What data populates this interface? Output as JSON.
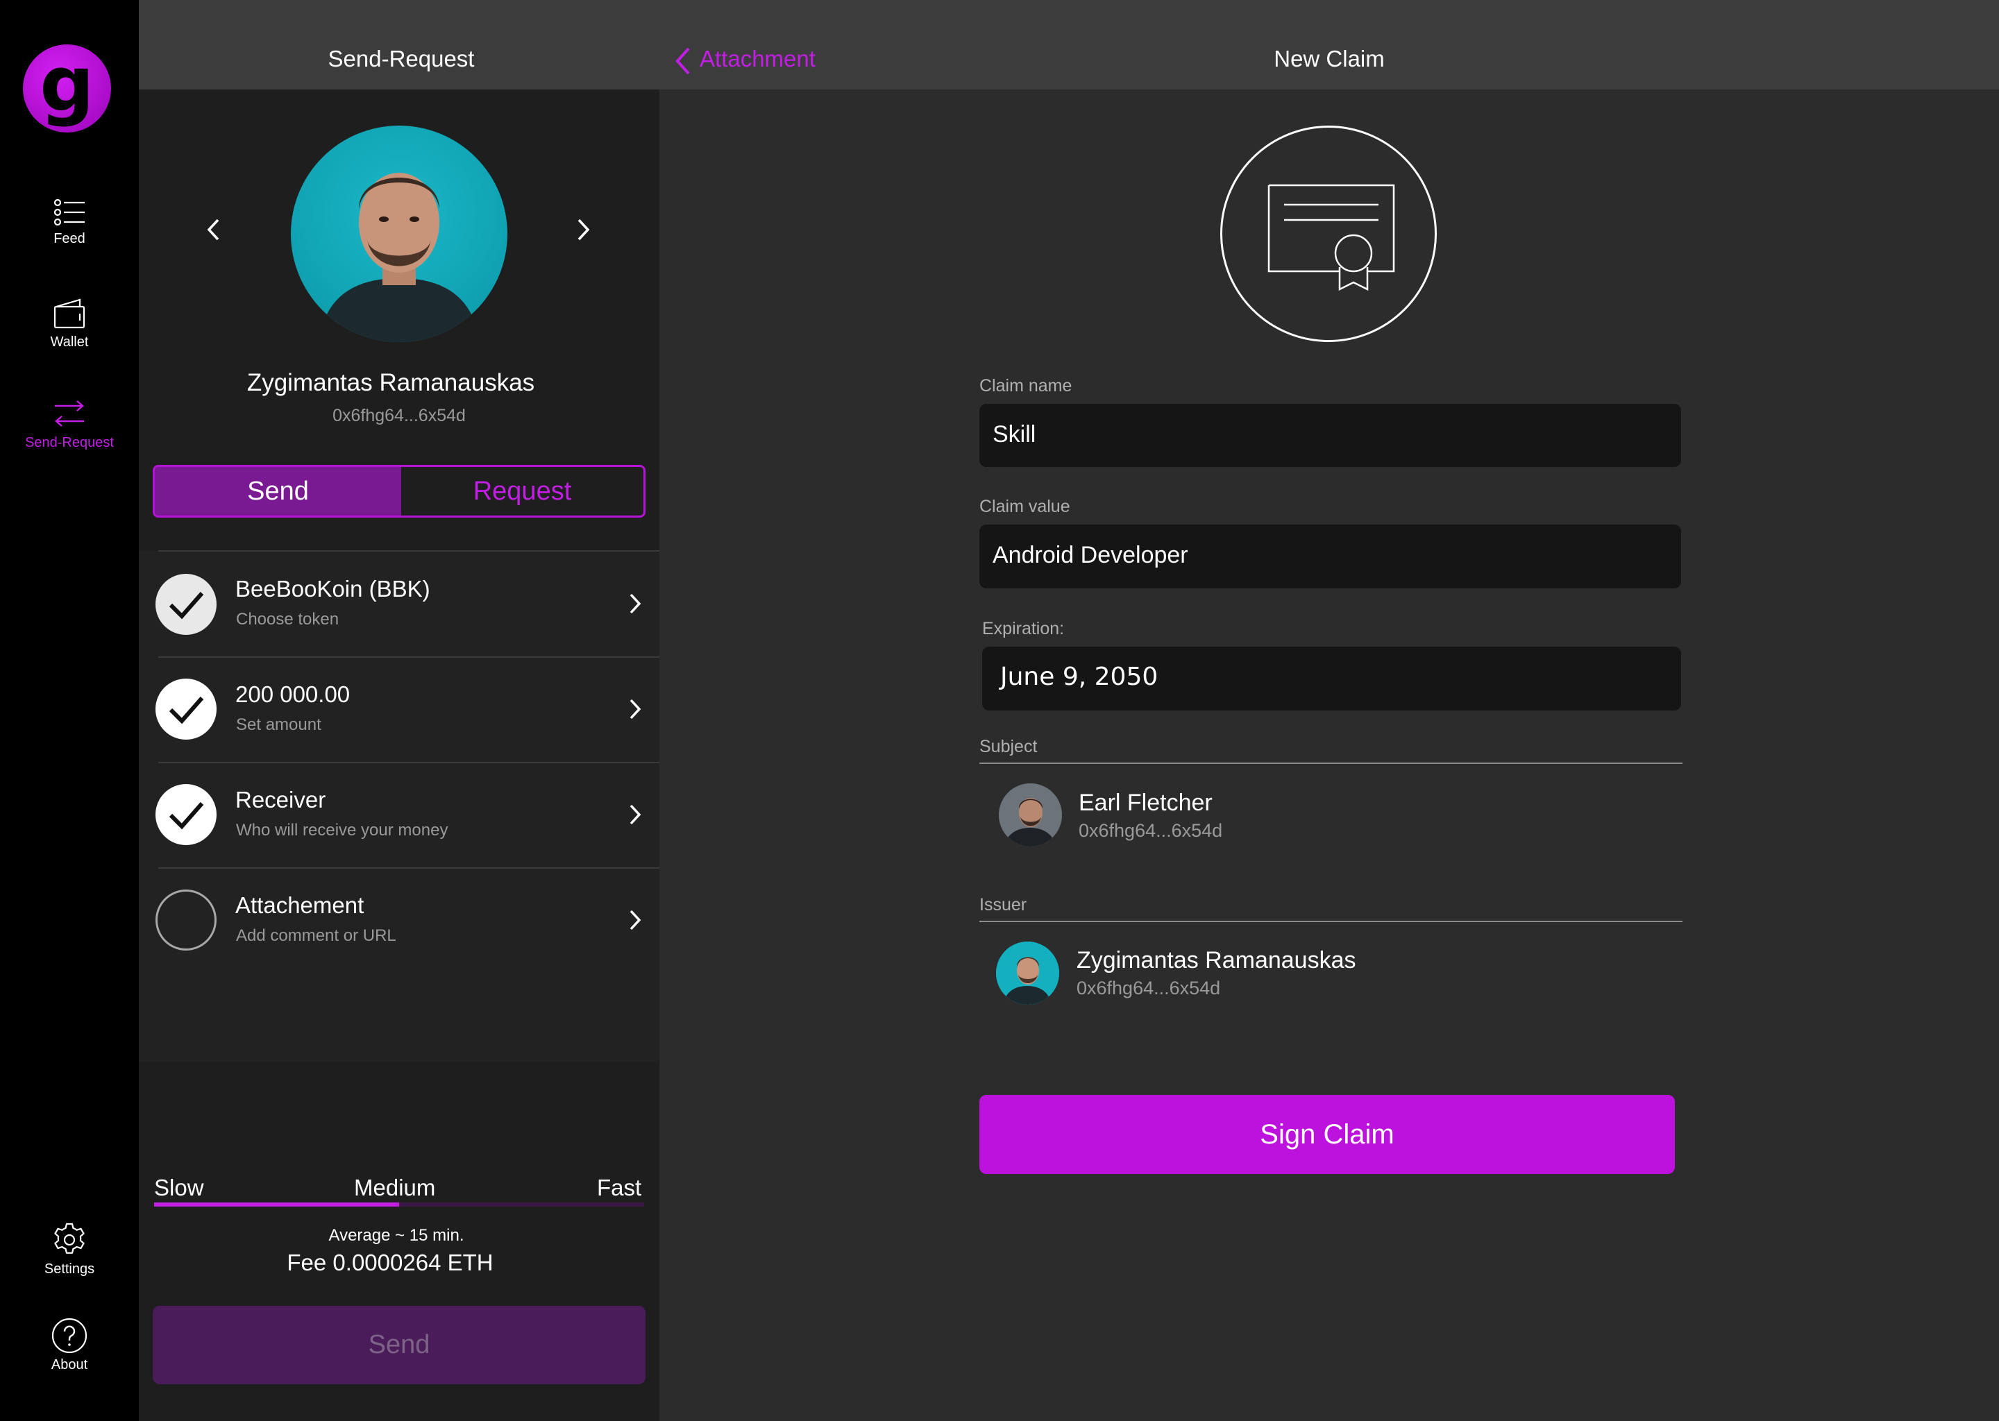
{
  "colors": {
    "accent": "#bd12dd",
    "nav_bg": "#000000",
    "topbar_bg": "#3c3c3c",
    "panel_bg": "#1e1e1e",
    "content_bg": "#2c2c2c",
    "field_bg": "#151515"
  },
  "nav": {
    "logo_letter": "g",
    "items": [
      {
        "label": "Feed",
        "icon": "list-icon"
      },
      {
        "label": "Wallet",
        "icon": "wallet-icon"
      },
      {
        "label": "Send-Request",
        "icon": "transfer-arrows-icon",
        "active": true
      }
    ],
    "bottom_items": [
      {
        "label": "Settings",
        "icon": "gear-icon"
      },
      {
        "label": "About",
        "icon": "question-circle-icon"
      }
    ]
  },
  "left_panel": {
    "title": "Send-Request",
    "profile": {
      "name": "Zygimantas Ramanauskas",
      "address": "0x6fhg64...6x54d"
    },
    "segment": {
      "options": [
        "Send",
        "Request"
      ],
      "selected": "Send"
    },
    "rows": [
      {
        "title": "BeeBooKoin (BBK)",
        "subtitle": "Choose token",
        "checked": true
      },
      {
        "title": "200 000.00",
        "subtitle": "Set amount",
        "checked": true
      },
      {
        "title": "Receiver",
        "subtitle": "Who will receive your money",
        "checked": true
      },
      {
        "title": "Attachement",
        "subtitle": "Add comment or URL",
        "checked": false
      }
    ],
    "fee": {
      "speeds": [
        "Slow",
        "Medium",
        "Fast"
      ],
      "selected": "Medium",
      "level": 0.5,
      "average": "Average ~ 15 min.",
      "fee_text": "Fee 0.0000264 ETH"
    },
    "send_button": "Send"
  },
  "right_panel": {
    "back_label": "Attachment",
    "title": "New Claim",
    "claim_name": {
      "label": "Claim name",
      "value": "Skill"
    },
    "claim_value": {
      "label": "Claim value",
      "value": "Android Developer"
    },
    "expiration": {
      "label": "Expiration:",
      "value": "June 9, 2050"
    },
    "subject": {
      "label": "Subject",
      "name": "Earl Fletcher",
      "address": "0x6fhg64...6x54d"
    },
    "issuer": {
      "label": "Issuer",
      "name": "Zygimantas Ramanauskas",
      "address": "0x6fhg64...6x54d"
    },
    "sign_button": "Sign Claim"
  }
}
